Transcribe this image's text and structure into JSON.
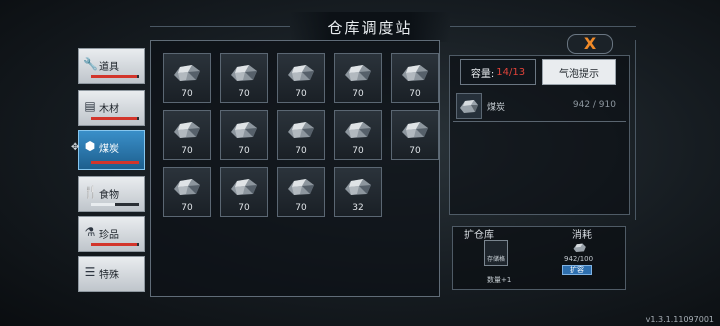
{
  "title": "仓库调度站",
  "close_symbol": "X",
  "sidebar": {
    "tabs": [
      {
        "label": "道具",
        "icon": "wrench-icon",
        "glyph": "🔧",
        "bar_fill": 0.95,
        "bar_color": "#d2352b",
        "active": false
      },
      {
        "label": "木材",
        "icon": "wood-icon",
        "glyph": "▤",
        "bar_fill": 0.95,
        "bar_color": "#d2352b",
        "active": false
      },
      {
        "label": "煤炭",
        "icon": "coal-cube-icon",
        "glyph": "⬢",
        "bar_fill": 1.0,
        "bar_color": "#d2352b",
        "active": true
      },
      {
        "label": "食物",
        "icon": "food-utensils-icon",
        "glyph": "🍴",
        "bar_fill": 0.5,
        "bar_color": "#e8ecef",
        "active": false
      },
      {
        "label": "珍品",
        "icon": "flask-icon",
        "glyph": "⚗",
        "bar_fill": 0.95,
        "bar_color": "#d2352b",
        "active": false
      },
      {
        "label": "特殊",
        "icon": "layers-icon",
        "glyph": "☰",
        "bar_fill": 0,
        "bar_color": "#d2352b",
        "active": false
      }
    ]
  },
  "slots": [
    "70",
    "70",
    "70",
    "70",
    "70",
    "70",
    "70",
    "70",
    "70",
    "70",
    "70",
    "70",
    "70",
    "32"
  ],
  "capacity": {
    "label": "容量:",
    "value": "14/13"
  },
  "bubble_tab": "气泡提示",
  "item_row": {
    "name": "煤炭",
    "amount": "942  /  910"
  },
  "expand": {
    "title": "扩仓库",
    "consume_title": "消耗",
    "storage_label": "存储格",
    "count_label": "数量+1",
    "consume_amount": "942/100",
    "button_label": "扩容"
  },
  "version": "v1.3.1.11097001"
}
